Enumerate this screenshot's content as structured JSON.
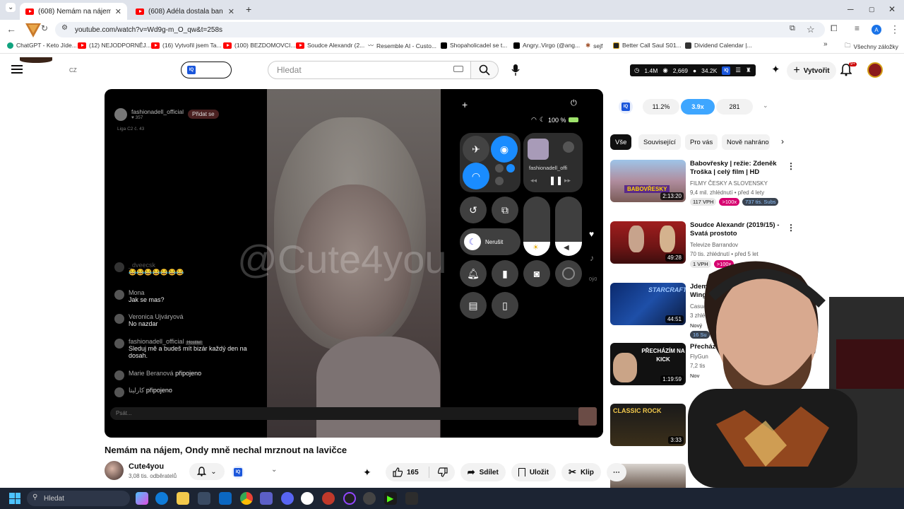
{
  "browser": {
    "tabs": [
      {
        "label": "(608) Nemám na nájem, Ondy"
      },
      {
        "label": "(608) Adéla dostala ban 😂 🍬"
      }
    ],
    "new_tab": "+",
    "url": "youtube.com/watch?v=Wd9g-m_O_qw&t=258s",
    "bookmarks": [
      {
        "label": "ChatGPT - Keto Jíde...",
        "color": "#10a37f"
      },
      {
        "label": "(12) NEJODPORNĚJ...",
        "color": "#ff0000"
      },
      {
        "label": "(16) Vytvořil jsem Ta...",
        "color": "#ff0000"
      },
      {
        "label": "(100) BEZDOMOVCI...",
        "color": "#ff0000"
      },
      {
        "label": "Soudce Alexandr (2...",
        "color": "#ff0000"
      },
      {
        "label": "Resemble AI - Custo...",
        "color": "#777777"
      },
      {
        "label": "Shopaholicadel se t...",
        "color": "#000000"
      },
      {
        "label": "Angry..Virgo (@ang...",
        "color": "#000000"
      },
      {
        "label": "sejf",
        "color": "#a0522d"
      },
      {
        "label": "Better Call Saul S01...",
        "color": "#222222"
      },
      {
        "label": "Dividend Calendar |...",
        "color": "#333333"
      }
    ],
    "all_bookmarks": "Všechny záložky"
  },
  "youtube": {
    "logo_region": "CZ",
    "search_placeholder": "Hledat",
    "stats": {
      "views": "1.4M",
      "a": "2,669",
      "b": "34.2K"
    },
    "create_label": "Vytvořit",
    "notif_count": "9+"
  },
  "player": {
    "watermark": "@Cute4you",
    "host_name": "fashionadell_official",
    "host_followers": "357",
    "follow_label": "Přidat se",
    "league": "Liga C2 č. 43",
    "chat": [
      {
        "name": "_dveecsk",
        "text": "😂😂😂😂😂😂😂"
      },
      {
        "name": "Mona",
        "text": "Jak se mas?"
      },
      {
        "name": "Veronica Ujváryová",
        "text": "No nazdar"
      },
      {
        "name": "fashionadell_official",
        "text": "Sleduj mě a budeš mít bizár každý den na dosah.",
        "tag": "Hostitel"
      },
      {
        "name": "Marie Beranová",
        "text": "připojeno"
      },
      {
        "name": "كارليتا",
        "text": "připojeno"
      }
    ],
    "chat_placeholder": "Psát...",
    "battery": "100 %",
    "media_title": "fashionadell_offi",
    "dnd_label": "Nerušit",
    "side_count": "0ý0"
  },
  "extension_bar": {
    "a": "11.2%",
    "b": "3.9x",
    "c": "281"
  },
  "chips": [
    "Vše",
    "Související",
    "Pro vás",
    "Nově nahráno"
  ],
  "recommendations": [
    {
      "title": "Babovřesky | režie: Zdeněk Troška | celý film | HD",
      "channel": "FILMY ČESKY A SLOVENSKY",
      "meta": "9,4 mil. zhlédnutí • před 4 lety",
      "duration": "2:13:20",
      "badges": [
        "117 VPH",
        ">100x",
        "737 tis. Subs"
      ],
      "thumb_text": "BABOVŘESKY"
    },
    {
      "title": "Soudce Alexandr (2019/15) - Svatá prostoto",
      "channel": "Televize Barrandov",
      "meta": "70 tis. zhlédnutí • před 5 let",
      "duration": "49:28",
      "badges": [
        "1 VPH",
        ">100x"
      ],
      "thumb_text": ""
    },
    {
      "title": "Jdeme gr Wings o",
      "channel": "Casual T",
      "meta": "3 zhlédn",
      "duration": "44:51",
      "badges": [
        "Nový",
        "16 Su"
      ],
      "thumb_text": "STARCRAFT"
    },
    {
      "title": "Přecházím",
      "channel": "FlyGun",
      "meta": "7,2 tis",
      "duration": "1:19:59",
      "badges": [
        "Nov"
      ],
      "thumb_text": "PŘECHÁZÍM NA KICK"
    },
    {
      "title": "",
      "channel": "",
      "meta": "",
      "duration": "3:33",
      "badges": [],
      "thumb_text": "CLASSIC ROCK"
    }
  ],
  "video": {
    "title": "Nemám na nájem, Ondy mně nechal mrznout na lavičce",
    "channel": "Cute4you",
    "subscribers": "3,08 tis. odběratelů",
    "likes": "165",
    "share": "Sdílet",
    "save": "Uložit",
    "clip": "Klip"
  },
  "taskbar": {
    "search_placeholder": "Hledat"
  }
}
